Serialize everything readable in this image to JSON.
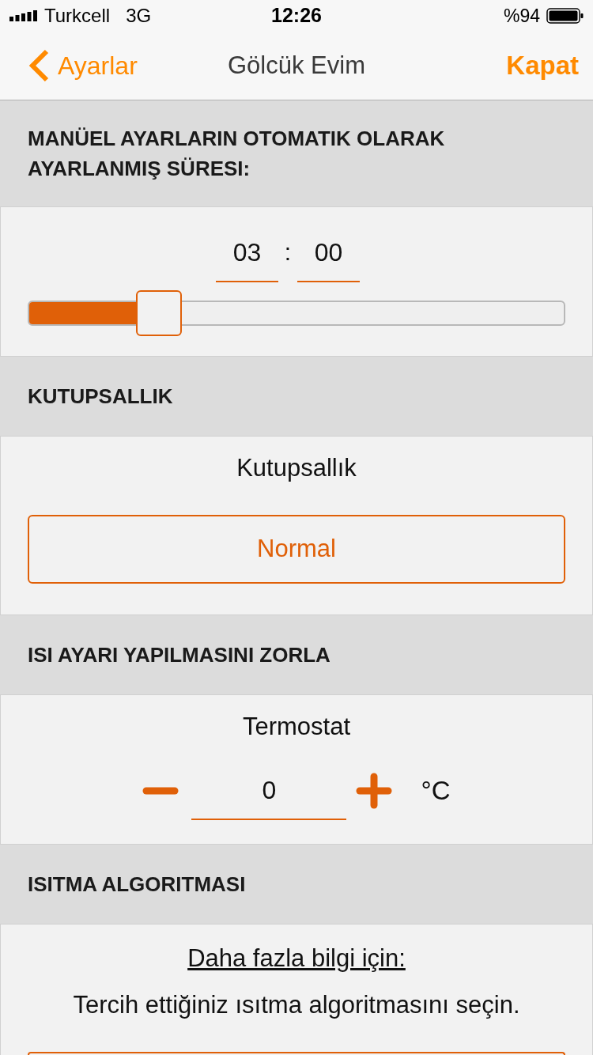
{
  "status_bar": {
    "carrier": "Turkcell",
    "network": "3G",
    "time": "12:26",
    "battery": "%94"
  },
  "nav": {
    "back": "Ayarlar",
    "title": "Gölcük Evim",
    "close": "Kapat"
  },
  "sections": [
    {
      "kind": "duration",
      "header": "MANÜEL AYARLARIN OTOMATIK OLARAK AYARLANMIŞ SÜRESI:",
      "hours": "03",
      "separator": ":",
      "minutes": "00",
      "level": 0.22
    },
    {
      "kind": "select",
      "header": "KUTUPSALLIK",
      "label": "Kutupsallık",
      "value": "Normal"
    },
    {
      "kind": "stepper",
      "header": "ISI AYARI YAPILMASINI ZORLA",
      "label": "Termostat",
      "value": "0",
      "unit": "°C"
    },
    {
      "kind": "info",
      "header": "ISITMA ALGORITMASI",
      "link": "Daha fazla bilgi için:",
      "text": "Tercih ettiğiniz ısıtma algoritmasını seçin.",
      "button_partly_visible": true
    }
  ]
}
